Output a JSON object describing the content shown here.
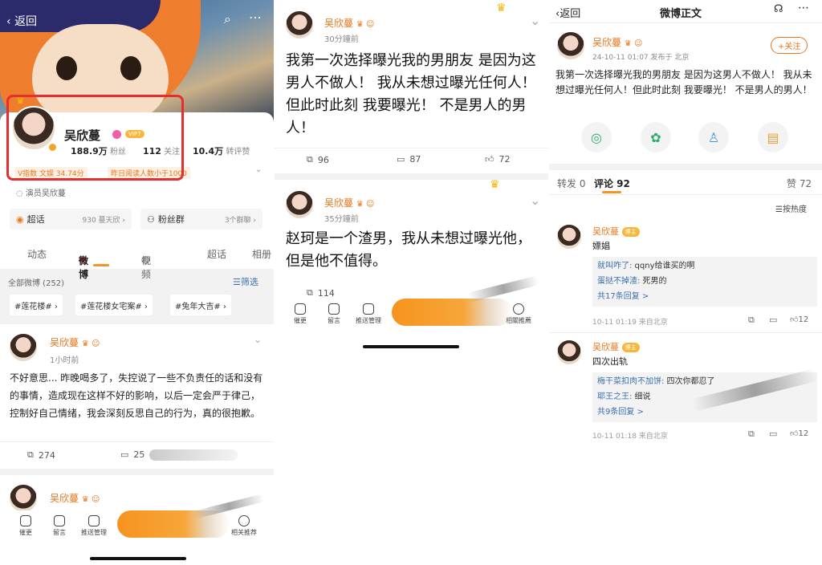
{
  "p1": {
    "back": "返回",
    "name": "吴欣蔓",
    "vip": "VIP7",
    "fans_num": "188.9万",
    "fans_label": "粉丝",
    "follow_num": "112",
    "follow_label": "关注",
    "repost_num": "10.4万",
    "repost_label": "转评赞",
    "v_index": "V指数 文娱 34.74分",
    "yesterday": "昨日阅读人数小于1000",
    "actor": "演员吴欣蔓",
    "chaohua": "超话",
    "chaohua_count": "930 蔓天欣 ›",
    "fans_group": "粉丝群",
    "group_count": "3个群聊 ›",
    "tabs": [
      "动态",
      "微博",
      "视频",
      "超话",
      "相册"
    ],
    "all_weibo": "全部微博 (252)",
    "filter": "筛选",
    "tags": [
      "#莲花楼# ›",
      "#莲花楼女宅案# ›",
      "#兔年大吉# ›"
    ],
    "post_name": "吴欣蔓",
    "post_time": "1小时前",
    "post_text": "不好意思... 昨晚喝多了，失控说了一些不负责任的话和没有的事情，造成现在这样不好的影响，以后一定会严于律己，控制好自己情绪，我会深刻反思自己的行为，真的很抱歉。",
    "reposts": "274",
    "comments": "25",
    "post2_name": "吴欣蔓",
    "nav": [
      "催更",
      "留言",
      "推送管理",
      "相关推荐"
    ]
  },
  "p2": {
    "post1_name": "吴欣蔓",
    "post1_time": "30分鐘前",
    "post1_text": "我第一次选择曝光我的男朋友 是因为这男人不做人！ 我从未想过曝光任何人！但此时此刻 我要曝光！ 不是男人的男人！",
    "p1_reposts": "96",
    "p1_comments": "87",
    "p1_likes": "72",
    "post2_name": "吴欣蔓",
    "post2_time": "35分鐘前",
    "post2_text": "赵珂是一个渣男，我从未想过曝光他， 但是他不值得。",
    "p2_reposts": "114",
    "nav": [
      "催更",
      "留言",
      "推送管理",
      "相關推薦"
    ]
  },
  "p3": {
    "back": "返回",
    "title": "微博正文",
    "name": "吴欣蔓",
    "follow": "+关注",
    "meta": "24-10-11 01:07  发布于 北京",
    "text": "我第一次选择曝光我的男朋友  是因为这男人不做人！ 我从未想过曝光任何人！但此时此刻 我要曝光！ 不是男人的男人！",
    "repost_tab": "转发 0",
    "comment_tab": "评论 92",
    "like_tab": "赞 72",
    "sort": "按热度",
    "c1_name": "吴欣蔓",
    "c1_badge": "博主",
    "c1_text": "嫖娼",
    "c1_r1_user": "就叫咋了:",
    "c1_r1_text": " qqny给谁买的啊",
    "c1_r2_user": "蛋挞不掉渣:",
    "c1_r2_text": " 死男的",
    "c1_more": "共17条回复 >",
    "c1_meta": "10-11 01:19  来自北京",
    "c1_likes": "12",
    "c2_name": "吴欣蔓",
    "c2_badge": "博主",
    "c2_text": "四次出轨",
    "c2_r1_user": "梅干菜扣肉不加饼:",
    "c2_r1_text": " 四次你都忍了",
    "c2_r2_user": "耶王之王:",
    "c2_r2_text": " 细说",
    "c2_more": "共9条回复 >",
    "c2_meta": "10-11 01:18  来自北京",
    "c2_likes": "12"
  },
  "colors": {
    "accent": "#f7931e",
    "name": "#e8761b",
    "highlight": "#e3302f",
    "link": "#3a6fb0"
  }
}
